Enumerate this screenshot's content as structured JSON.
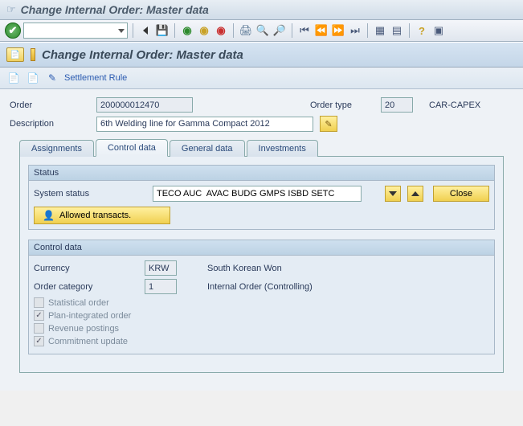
{
  "window": {
    "title": "Change Internal Order: Master data"
  },
  "page": {
    "title": "Change Internal Order: Master data"
  },
  "subtoolbar": {
    "settlement_rule": "Settlement Rule"
  },
  "form": {
    "order_label": "Order",
    "order_value": "200000012470",
    "order_type_label": "Order type",
    "order_type_value": "20",
    "order_type_text": "CAR-CAPEX",
    "description_label": "Description",
    "description_value": "6th Welding line for Gamma Compact 2012"
  },
  "tabs": {
    "assignments": "Assignments",
    "control_data": "Control data",
    "general_data": "General data",
    "investments": "Investments"
  },
  "status_group": {
    "title": "Status",
    "system_status_label": "System status",
    "system_status_value": "TECO AUC  AVAC BUDG GMPS ISBD SETC",
    "close_label": "Close",
    "allowed_label": "Allowed transacts."
  },
  "control_group": {
    "title": "Control data",
    "currency_label": "Currency",
    "currency_value": "KRW",
    "currency_text": "South Korean Won",
    "category_label": "Order category",
    "category_value": "1",
    "category_text": "Internal Order (Controlling)",
    "statistical": "Statistical order",
    "plan_integrated": "Plan-integrated order",
    "revenue": "Revenue postings",
    "commitment": "Commitment update"
  }
}
